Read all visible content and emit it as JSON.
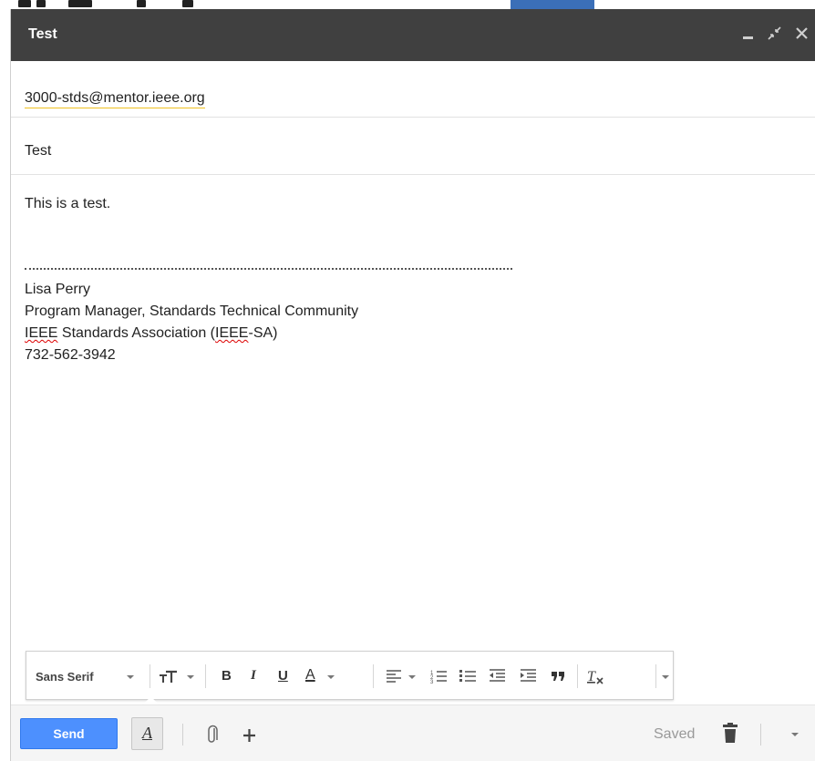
{
  "window": {
    "title": "Test"
  },
  "compose": {
    "to": "3000-stds@mentor.ieee.org",
    "subject": "Test",
    "body": {
      "line1": "This is a test.",
      "signature": {
        "name": "Lisa Perry",
        "role": "Program Manager, Standards Technical Community",
        "org_word1": "IEEE",
        "org_mid": " Standards Association (",
        "org_word2": "IEEE",
        "org_end": "-SA)",
        "phone": "732-562-3942"
      }
    }
  },
  "format_toolbar": {
    "font": "Sans Serif",
    "icons": [
      "text-size-icon",
      "bold-icon",
      "italic-icon",
      "underline-icon",
      "text-color-icon",
      "align-icon",
      "numbered-list-icon",
      "bulleted-list-icon",
      "indent-less-icon",
      "indent-more-icon",
      "quote-icon",
      "remove-formatting-icon",
      "more-options-icon"
    ],
    "bold_glyph": "B",
    "italic_glyph": "I",
    "underline_glyph": "U",
    "color_glyph": "A"
  },
  "bottom_bar": {
    "send_label": "Send",
    "format_glyph": "A",
    "status": "Saved",
    "accent_color": "#4d90fe"
  }
}
